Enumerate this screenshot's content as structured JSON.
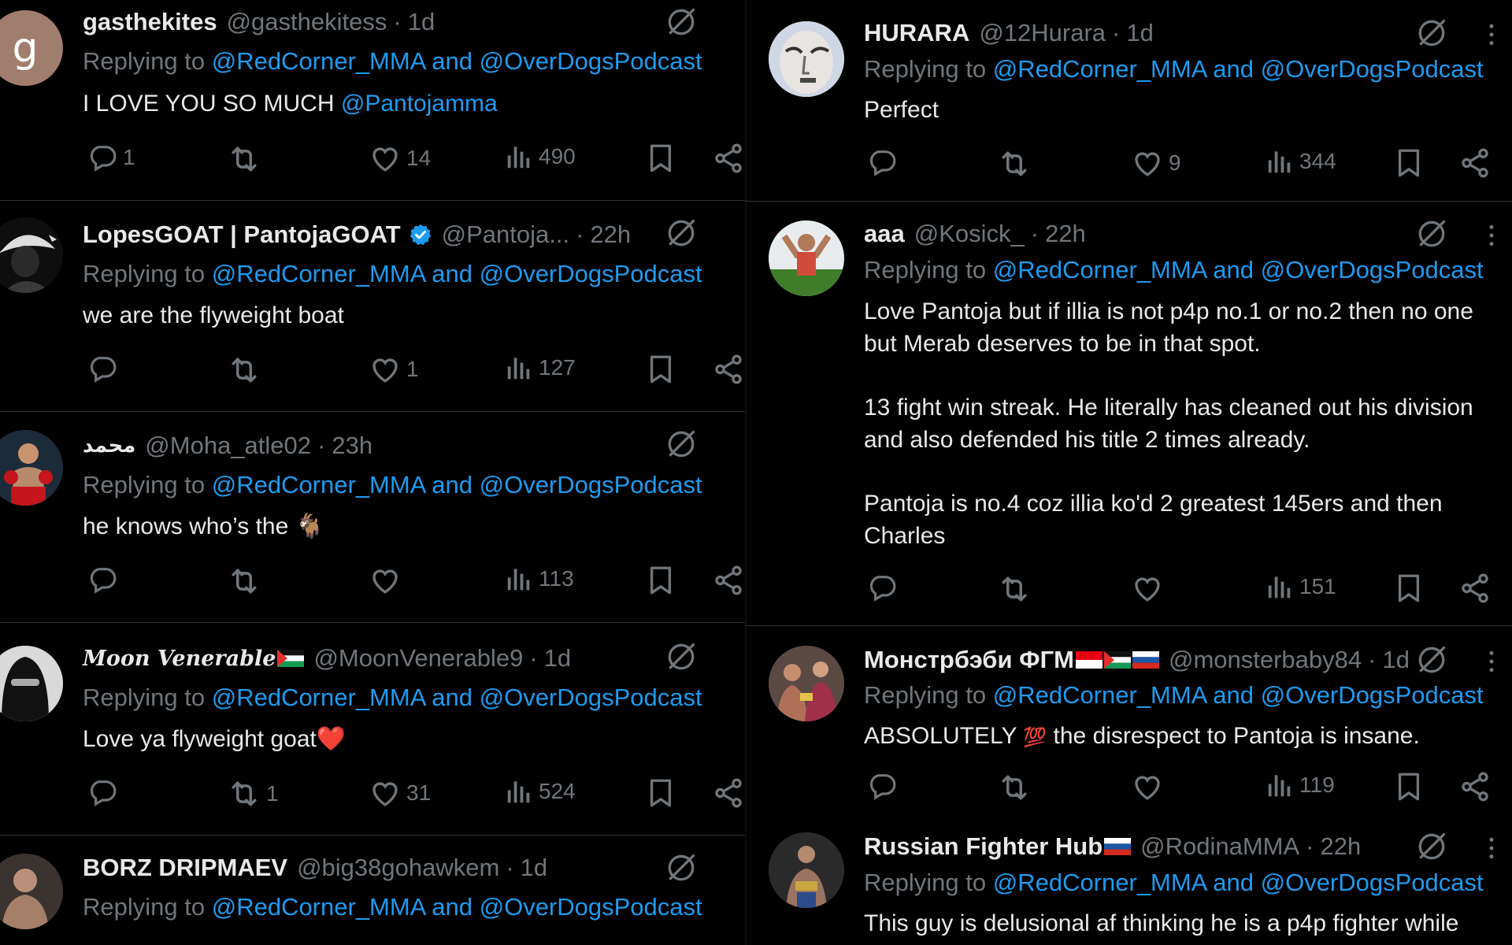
{
  "colors": {
    "background": "#000000",
    "text": "#e7e9ea",
    "muted": "#71767b",
    "link": "#1d9bf0",
    "verified": "#1d9bf0",
    "heart": "#f91880"
  },
  "reply_prefix": "Replying to",
  "reply_targets": "@RedCorner_MMA and @OverDogsPodcast",
  "left_column": [
    {
      "avatar": {
        "letter": "g",
        "color": "#a17d6e"
      },
      "name": "gasthekites",
      "handle": "@gasthekitess",
      "time": "1d",
      "body_text": "I LOVE YOU SO MUCH ",
      "body_mention": "@Pantojamma",
      "replies": "1",
      "reposts": "",
      "likes": "14",
      "views": "490"
    },
    {
      "avatar": {
        "icon": "masked-man-avatar"
      },
      "name": "LopesGOAT | PantojaGOAT",
      "verified": true,
      "handle": "@Pantoja...",
      "time": "22h",
      "body_text": "we are the flyweight boat",
      "replies": "",
      "reposts": "",
      "likes": "1",
      "views": "127"
    },
    {
      "avatar": {
        "icon": "boxer-avatar"
      },
      "name": "محمد",
      "handle": "@Moha_atle02",
      "time": "23h",
      "body_text": "he knows who’s the ",
      "body_emoji": "🐐",
      "replies": "",
      "reposts": "",
      "likes": "",
      "views": "113"
    },
    {
      "avatar": {
        "icon": "masked-face-avatar"
      },
      "name": "Moon Venerable",
      "name_flag": "palestine-flag",
      "handle": "@MoonVenerable9",
      "time": "1d",
      "body_text": "Love ya flyweight goat",
      "body_emoji": "❤️",
      "replies": "",
      "reposts": "1",
      "likes": "31",
      "views": "524"
    },
    {
      "avatar": {
        "icon": "fighter-avatar"
      },
      "name": "BORZ DRIPMAEV",
      "handle": "@big38gohawkem",
      "time": "1d"
    }
  ],
  "right_column": [
    {
      "avatar": {
        "icon": "face-closeup-avatar"
      },
      "name": "HURARA",
      "handle": "@12Hurara",
      "time": "1d",
      "body_text": "Perfect",
      "replies": "",
      "reposts": "",
      "likes": "9",
      "views": "344"
    },
    {
      "avatar": {
        "icon": "fighter-celebrating-avatar"
      },
      "name": "aaa",
      "handle": "@Kosick_",
      "time": "22h",
      "body_paragraphs": [
        "Love Pantoja but if illia is not p4p no.1 or no.2 then no one but Merab deserves to be in that spot.",
        "13 fight win streak. He literally has cleaned out his division and also defended his title 2 times already.",
        "Pantoja is no.4 coz illia ko'd 2 greatest 145ers and then Charles"
      ],
      "replies": "",
      "reposts": "",
      "likes": "",
      "views": "151"
    },
    {
      "avatar": {
        "icon": "fighters-collage-avatar"
      },
      "name": "Монстрбэби ФГМ",
      "name_flags": [
        "indonesia-flag",
        "palestine-flag",
        "russia-flag"
      ],
      "handle": "@monsterbaby84",
      "time": "1d",
      "body_text": "ABSOLUTELY ",
      "body_emoji": "💯",
      "body_text2": " the disrespect to Pantoja is insane.",
      "replies": "",
      "reposts": "",
      "likes": "",
      "views": "119"
    },
    {
      "avatar": {
        "icon": "fighter-belt-avatar"
      },
      "name": "Russian Fighter Hub",
      "name_flag": "russia-flag",
      "handle": "@RodinaMMA",
      "time": "22h",
      "body_text": "This guy is delusional af thinking he is a p4p fighter while"
    }
  ]
}
